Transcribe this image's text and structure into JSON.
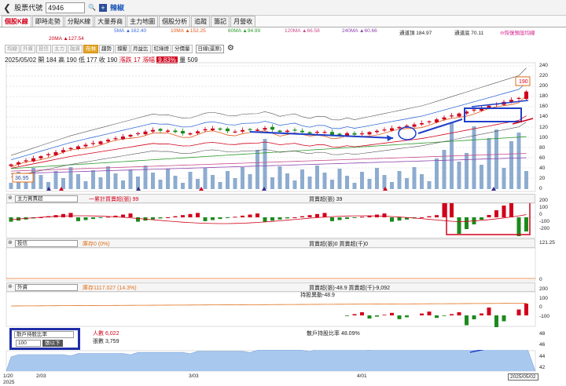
{
  "topbar": {
    "back_glyph": "❮",
    "title": "股票代號",
    "code": "4946",
    "search_glyph": "🔍",
    "plus_glyph": "+",
    "stock_name": "辣椒"
  },
  "tabs": [
    "個股K線",
    "即時走勢",
    "分點K線",
    "大量券商",
    "主力地圖",
    "個股分析",
    "追蹤",
    "籌記",
    "月營收"
  ],
  "active_tab_index": 0,
  "ma": {
    "ma5": "5MA ▲162.40",
    "ma10": "10MA ▲152.25",
    "ma20": "20MA ▲127.54",
    "ma60": "60MA ▲94.99",
    "ma120": "120MA ▲66.58",
    "ma240": "240MA ▲60.66",
    "upper_band": "通道頂 184.97",
    "lower_band": "通道底 70.11",
    "clear_link": "⊖恢復預設均線",
    "colors": {
      "ma5": "#3b6ed8",
      "ma10": "#e05a1b",
      "ma20": "#d0021b",
      "ma60": "#2c9a2c",
      "ma120": "#c84a8a",
      "ma240": "#8e44ad"
    }
  },
  "toolbar": {
    "items": [
      "均線",
      "外資",
      "投信",
      "主力",
      "融資",
      "布林",
      "趨勢",
      "撐壓",
      "月益比",
      "紅綠燈",
      "分價量"
    ],
    "selected": "布林",
    "period": "日線(還原)",
    "gear_glyph": "⚙"
  },
  "quote": {
    "date": "2025/05/02",
    "open_label": "開",
    "open": "184",
    "high_label": "高",
    "high": "190",
    "low_label": "低",
    "low": "177",
    "close_label": "收",
    "close": "190",
    "change": "漲跌 17",
    "pct_label": "漲幅",
    "pct": "9.83%",
    "vol_label": "量",
    "vol": "509"
  },
  "main_chart": {
    "high_marker": "190",
    "low_marker": "36.95",
    "y_ticks": [
      "240",
      "220",
      "200",
      "180",
      "160",
      "140",
      "120",
      "100",
      "80",
      "60",
      "40",
      "20",
      "0"
    ]
  },
  "panel1": {
    "selector": "主力買賣超",
    "legend1": "一累計買賣超(張) 99",
    "legend2": "買賣超(張) 39",
    "y_ticks": [
      "200",
      "100",
      "0",
      "-100",
      "-200"
    ]
  },
  "panel2": {
    "selector": "投信",
    "legend1": "庫存0 (0%)",
    "legend2": "買賣超(張)0 買賣超(千)0",
    "y_ticks": [
      "121.25",
      "0"
    ]
  },
  "panel3": {
    "selector": "外資",
    "legend1": "庫存1117.027 (14.3%)",
    "legend2": "買賣超(張)-48.9 買賣超(千)-9,092",
    "legend3": "持股異動-48.9",
    "y_ticks": [
      "200",
      "100",
      "0",
      "-100"
    ]
  },
  "panel4": {
    "selector": "散戶持股比率",
    "threshold": "100",
    "threshold_suffix": "張以下",
    "legend1": "人數 6,022",
    "legend2": "張數 3,759",
    "legend3": "散戶持股比率 48.09%",
    "y_ticks": [
      "48",
      "46",
      "44",
      "42"
    ]
  },
  "dates": {
    "d1": "1/20",
    "d1y": "2025",
    "d2": "2/03",
    "d3": "3/03",
    "d4": "4/01",
    "current": "2025/05/02"
  }
}
